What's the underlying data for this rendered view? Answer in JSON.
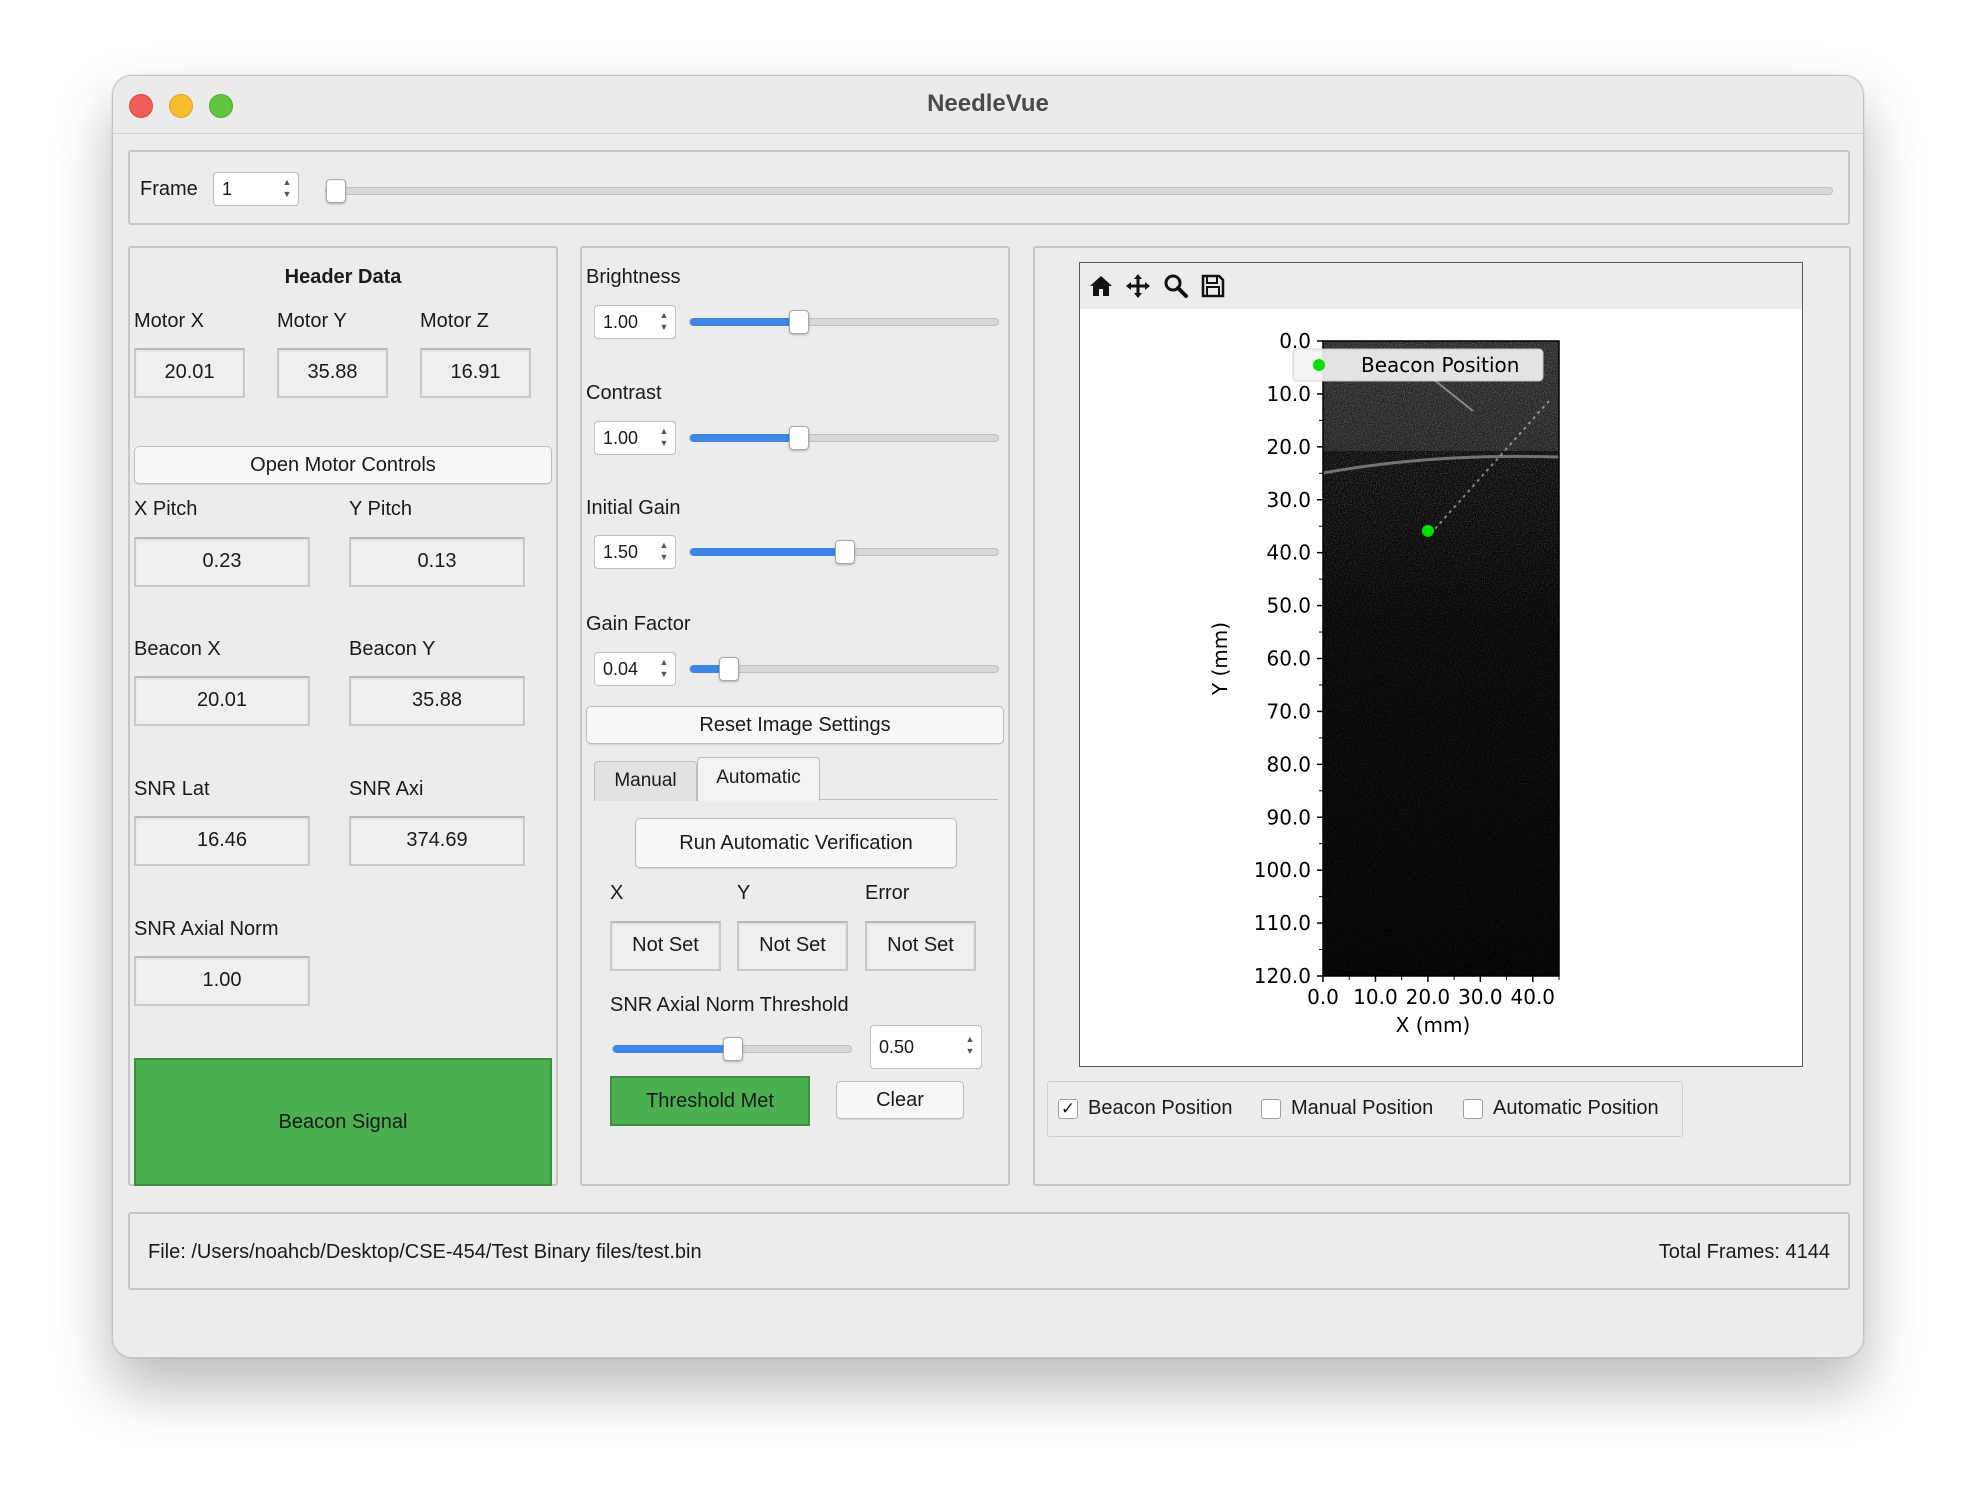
{
  "window": {
    "title": "NeedleVue"
  },
  "frame": {
    "label": "Frame",
    "value": "1",
    "fraction": 0.0
  },
  "header": {
    "title": "Header Data",
    "motor_x_label": "Motor X",
    "motor_x": "20.01",
    "motor_y_label": "Motor Y",
    "motor_y": "35.88",
    "motor_z_label": "Motor Z",
    "motor_z": "16.91",
    "open_motor_controls": "Open Motor Controls",
    "x_pitch_label": "X Pitch",
    "x_pitch": "0.23",
    "y_pitch_label": "Y Pitch",
    "y_pitch": "0.13",
    "beacon_x_label": "Beacon X",
    "beacon_x": "20.01",
    "beacon_y_label": "Beacon Y",
    "beacon_y": "35.88",
    "snr_lat_label": "SNR Lat",
    "snr_lat": "16.46",
    "snr_axi_label": "SNR Axi",
    "snr_axi": "374.69",
    "snr_axial_norm_label": "SNR Axial Norm",
    "snr_axial_norm": "1.00",
    "beacon_signal": "Beacon Signal",
    "beacon_signal_color": "#4caf50"
  },
  "image_settings": {
    "brightness_label": "Brightness",
    "brightness": "1.00",
    "brightness_fraction": 0.34,
    "contrast_label": "Contrast",
    "contrast": "1.00",
    "contrast_fraction": 0.34,
    "initial_gain_label": "Initial Gain",
    "initial_gain": "1.50",
    "initial_gain_fraction": 0.5,
    "gain_factor_label": "Gain Factor",
    "gain_factor": "0.04",
    "gain_factor_fraction": 0.1,
    "reset": "Reset Image Settings",
    "accent_color": "#3d86e8"
  },
  "verification": {
    "tabs": [
      {
        "label": "Manual",
        "active": false
      },
      {
        "label": "Automatic",
        "active": true
      }
    ],
    "run": "Run Automatic Verification",
    "x_label": "X",
    "y_label": "Y",
    "error_label": "Error",
    "x_value": "Not Set",
    "y_value": "Not Set",
    "error_value": "Not Set",
    "threshold_label": "SNR Axial Norm Threshold",
    "threshold": "0.50",
    "threshold_fraction": 0.5,
    "threshold_met": "Threshold Met",
    "threshold_met_color": "#4caf50",
    "clear": "Clear"
  },
  "plot_toolbar": {
    "icons": [
      "home-icon",
      "pan-icon",
      "zoom-icon",
      "save-icon"
    ]
  },
  "chart_data": {
    "type": "scatter",
    "xlabel": "X (mm)",
    "ylabel": "Y (mm)",
    "xlim": [
      0,
      45
    ],
    "ylim": [
      120,
      0
    ],
    "x_ticks": [
      "0.0",
      "10.0",
      "20.0",
      "30.0",
      "40.0"
    ],
    "y_ticks": [
      "0.0",
      "10.0",
      "20.0",
      "30.0",
      "40.0",
      "50.0",
      "60.0",
      "70.0",
      "80.0",
      "90.0",
      "100.0",
      "110.0",
      "120.0"
    ],
    "background": "ultrasound image (grayscale)",
    "series": [
      {
        "name": "Beacon Position",
        "x": [
          20.01
        ],
        "y": [
          35.88
        ],
        "color": "#00e000"
      }
    ],
    "legend": "top"
  },
  "plot_options": [
    {
      "label": "Beacon Position",
      "checked": true
    },
    {
      "label": "Manual Position",
      "checked": false
    },
    {
      "label": "Automatic Position",
      "checked": false
    }
  ],
  "status": {
    "file": "File: /Users/noahcb/Desktop/CSE-454/Test Binary files/test.bin",
    "total_frames": "Total Frames: 4144"
  }
}
